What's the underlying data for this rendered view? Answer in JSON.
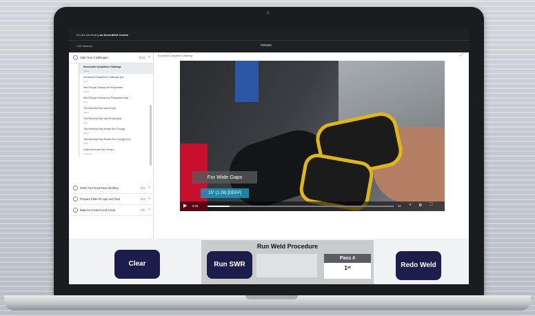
{
  "app": {
    "notice_prefix": "You are previewing",
    "notice_course": "an Accredited Course",
    "back_label": "< All Lessons",
    "brand": "novarc"
  },
  "sidebar": {
    "modules": [
      {
        "label": "Start Your Challenges",
        "count": "5/10",
        "expanded": true
      },
      {
        "label": "Weld Your Root Pass Welding",
        "count": "0/4",
        "expanded": false
      },
      {
        "label": "Prepare Plate Fit-Ups and Tack",
        "count": "0/3",
        "expanded": false
      },
      {
        "label": "Balance Content and Cover",
        "count": "0/2",
        "expanded": false
      }
    ],
    "lessons": [
      {
        "title": "Successful Completion Challenge",
        "meta": "Video",
        "active": true
      },
      {
        "title": "Successful Completion Challenge Quiz",
        "meta": "Quiz",
        "active": false
      },
      {
        "title": "Wind Rough Cleanup and Preparation",
        "meta": "Video",
        "active": false
      },
      {
        "title": "Wind Rough Cleanup and Preparation Quiz",
        "meta": "Quiz",
        "active": false
      },
      {
        "title": "Test Workflow Pipe and Fit-Ups",
        "meta": "Video",
        "active": false
      },
      {
        "title": "Test Workflow Pipe and Fit-Ups Quiz",
        "meta": "Quiz",
        "active": false
      },
      {
        "title": "Test Workflow Pipe Rotate Run Through",
        "meta": "Video",
        "active": false
      },
      {
        "title": "Test Workflow Pipe Rotate Run Through Quiz",
        "meta": "Quiz",
        "active": false
      },
      {
        "title": "Finish Weld and Pipe Fit-Ups",
        "meta": "Complete",
        "active": false
      }
    ]
  },
  "main": {
    "breadcrumb": "Successful Completion Challenge"
  },
  "video": {
    "caption": "For Wide Gaps",
    "code": "15° (1.28) [DEEP]",
    "time": "0:45",
    "speed": "1x",
    "progress": 0.12
  },
  "controls": {
    "clear_label": "Clear",
    "run_procedure_title": "Run Weld Procedure",
    "run_swr_label": "Run SWR",
    "pass_label": "Pass #",
    "pass_value": "1ˢᵗ",
    "redo_label": "Redo Weld"
  },
  "colors": {
    "button_navy": "#1c1d4a",
    "caption_cyan": "#1896be",
    "header_dark": "#1e2024"
  }
}
